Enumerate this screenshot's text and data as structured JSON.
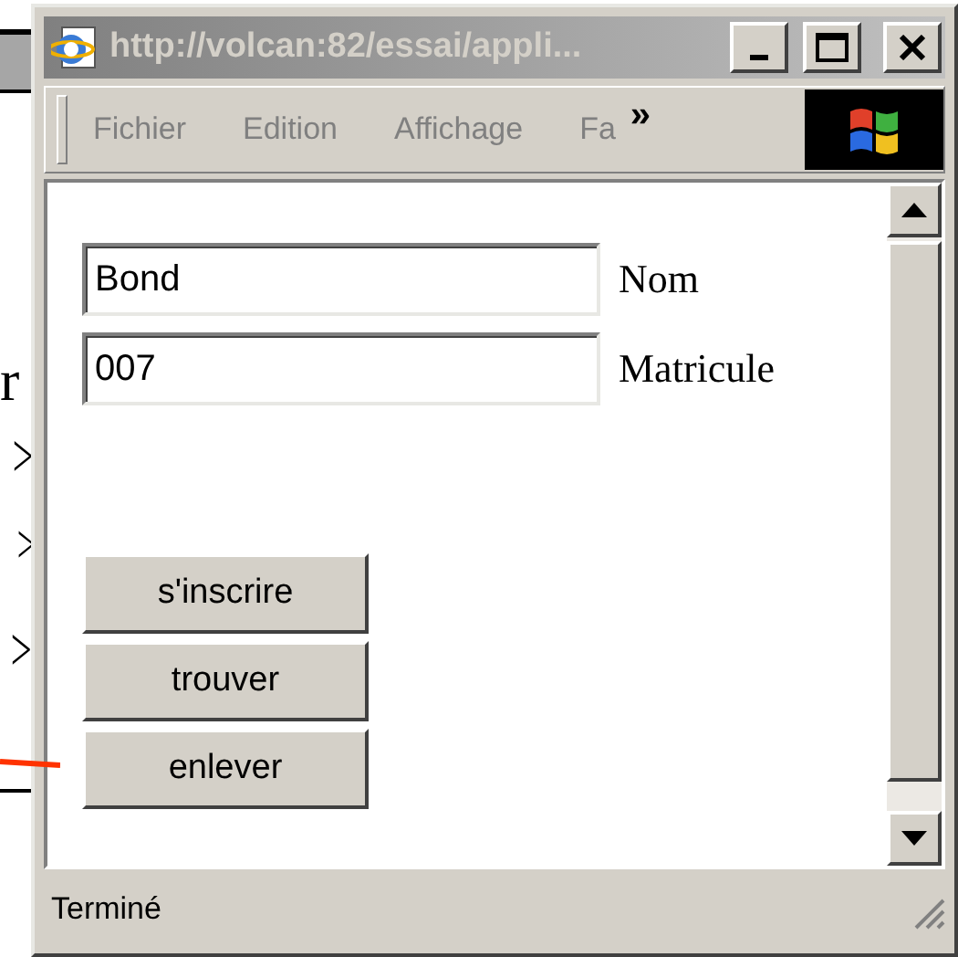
{
  "background_page": {
    "texts": [
      "r",
      ">",
      ">",
      ">"
    ]
  },
  "window": {
    "title": "http://volcan:82/essai/appli...",
    "active": false
  },
  "menu": [
    {
      "label": "Fichier"
    },
    {
      "label": "Edition"
    },
    {
      "label": "Affichage"
    },
    {
      "label": "Fa"
    }
  ],
  "menu_overflow": "»",
  "fields": [
    {
      "value": "Bond",
      "label": "Nom"
    },
    {
      "value": "007",
      "label": "Matricule"
    }
  ],
  "buttons": [
    "s'inscrire",
    "trouver",
    "enlever"
  ],
  "status_bar": "Terminé"
}
